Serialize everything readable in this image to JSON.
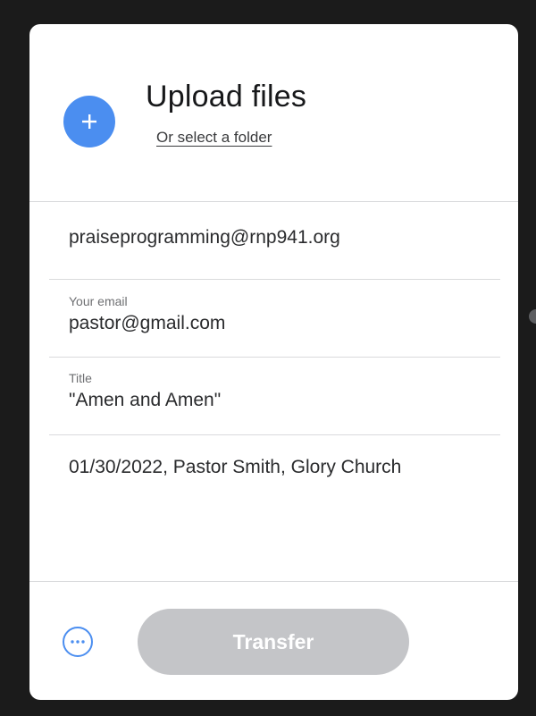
{
  "upload": {
    "title": "Upload files",
    "select_folder_link": "Or select a folder",
    "add_icon": "plus-icon"
  },
  "form": {
    "recipient": {
      "value": "praiseprogramming@rnp941.org"
    },
    "your_email": {
      "label": "Your email",
      "value": "pastor@gmail.com"
    },
    "title": {
      "label": "Title",
      "value": "\"Amen and Amen\""
    },
    "message": {
      "value": "01/30/2022, Pastor Smith, Glory Church"
    }
  },
  "footer": {
    "more_icon": "more-options-icon",
    "transfer_label": "Transfer"
  },
  "colors": {
    "accent": "#4b8ef0",
    "disabled_button": "#c4c5c8",
    "background": "#1b1b1b",
    "card": "#ffffff"
  }
}
